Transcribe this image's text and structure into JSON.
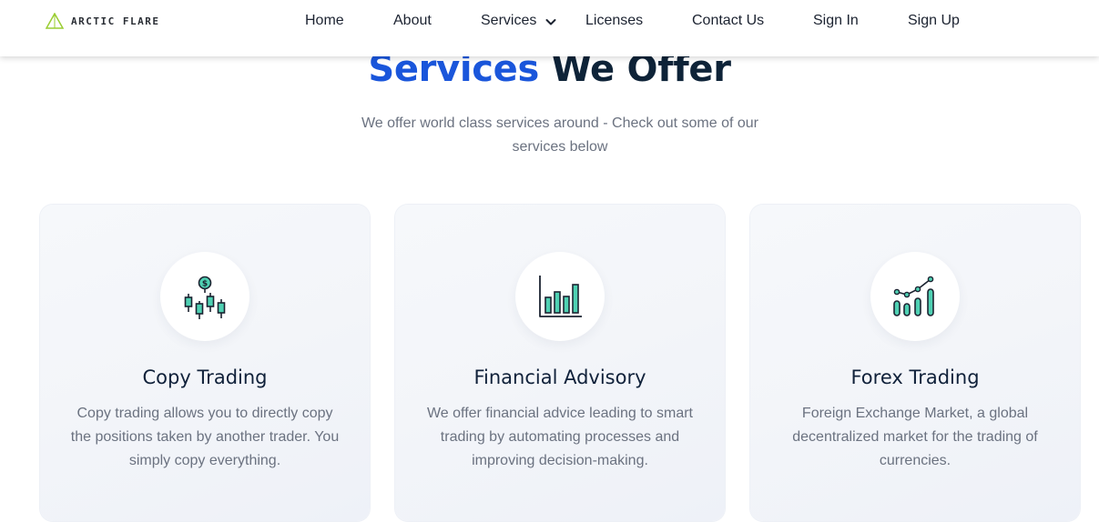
{
  "header": {
    "logo_text": "ARCTIC FLARE",
    "nav": {
      "home": "Home",
      "about": "About",
      "services": "Services",
      "licenses": "Licenses",
      "contact": "Contact Us",
      "signin": "Sign In",
      "signup": "Sign Up"
    }
  },
  "section": {
    "title_accent": "Services",
    "title_rest": "We Offer",
    "subtitle": "We offer world class services around - Check out some of our services below"
  },
  "cards": [
    {
      "title": "Copy Trading",
      "description": "Copy trading allows you to directly copy the positions taken by another trader. You simply copy everything.",
      "icon": "candlestick-chart-icon"
    },
    {
      "title": "Financial Advisory",
      "description": "We offer financial advice leading to smart trading by automating processes and improving decision-making.",
      "icon": "bar-chart-icon"
    },
    {
      "title": "Forex Trading",
      "description": "Foreign Exchange Market, a global decentralized market for the trading of currencies.",
      "icon": "growth-chart-icon"
    }
  ],
  "colors": {
    "accent_blue": "#1a56db",
    "heading_dark": "#0e2338",
    "icon_teal": "#4fd1b3",
    "icon_outline": "#1c2331",
    "logo_green": "#9acd32",
    "card_bg": "#f3f5f9"
  }
}
